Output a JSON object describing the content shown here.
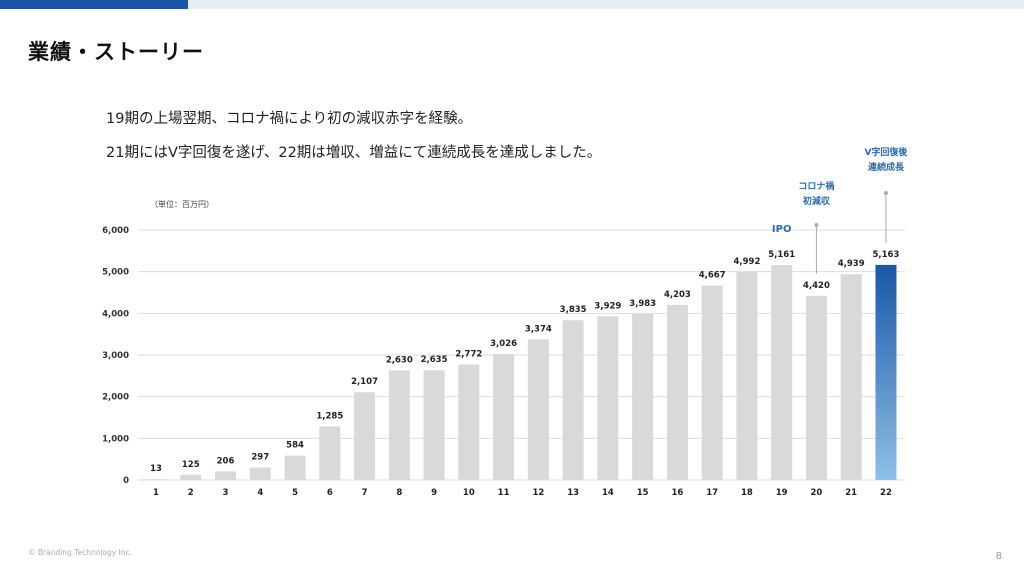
{
  "header": {
    "title": "業績・ストーリー"
  },
  "summary": {
    "line1": "19期の上場翌期、コロナ禍により初の減収赤字を経験。",
    "line2": "21期にはV字回復を遂げ、22期は増収、増益にて連続成長を達成しました。"
  },
  "footer": {
    "copyright": "© Branding Technology Inc.",
    "page_number": "8"
  },
  "colors": {
    "bar": "#d9d9d9",
    "highlight_top": "#1a56a8",
    "highlight_bottom": "#8fc0e6",
    "annotation": "#2a6bb8",
    "grid": "#dddddd"
  },
  "chart_data": {
    "type": "bar",
    "unit_label": "（単位：百万円）",
    "categories": [
      "1",
      "2",
      "3",
      "4",
      "5",
      "6",
      "7",
      "8",
      "9",
      "10",
      "11",
      "12",
      "13",
      "14",
      "15",
      "16",
      "17",
      "18",
      "19",
      "20",
      "21",
      "22"
    ],
    "values": [
      13,
      125,
      206,
      297,
      584,
      1285,
      2107,
      2630,
      2635,
      2772,
      3026,
      3374,
      3835,
      3929,
      3983,
      4203,
      4667,
      4992,
      5161,
      4420,
      4939,
      5163
    ],
    "value_labels": [
      "13",
      "125",
      "206",
      "297",
      "584",
      "1,285",
      "2,107",
      "2,630",
      "2,635",
      "2,772",
      "3,026",
      "3,374",
      "3,835",
      "3,929",
      "3,983",
      "4,203",
      "4,667",
      "4,992",
      "5,161",
      "4,420",
      "4,939",
      "5,163"
    ],
    "ylim": [
      0,
      6000
    ],
    "yticks": [
      0,
      1000,
      2000,
      3000,
      4000,
      5000,
      6000
    ],
    "ytick_labels": [
      "0",
      "1,000",
      "2,000",
      "3,000",
      "4,000",
      "5,000",
      "6,000"
    ],
    "grid": true,
    "highlight_category": "22",
    "annotations": [
      {
        "category": "19",
        "lines": [
          "IPO"
        ]
      },
      {
        "category": "20",
        "lines": [
          "コロナ禍",
          "初減収"
        ]
      },
      {
        "category": "22",
        "lines": [
          "V字回復後",
          "連続成長"
        ]
      }
    ]
  }
}
